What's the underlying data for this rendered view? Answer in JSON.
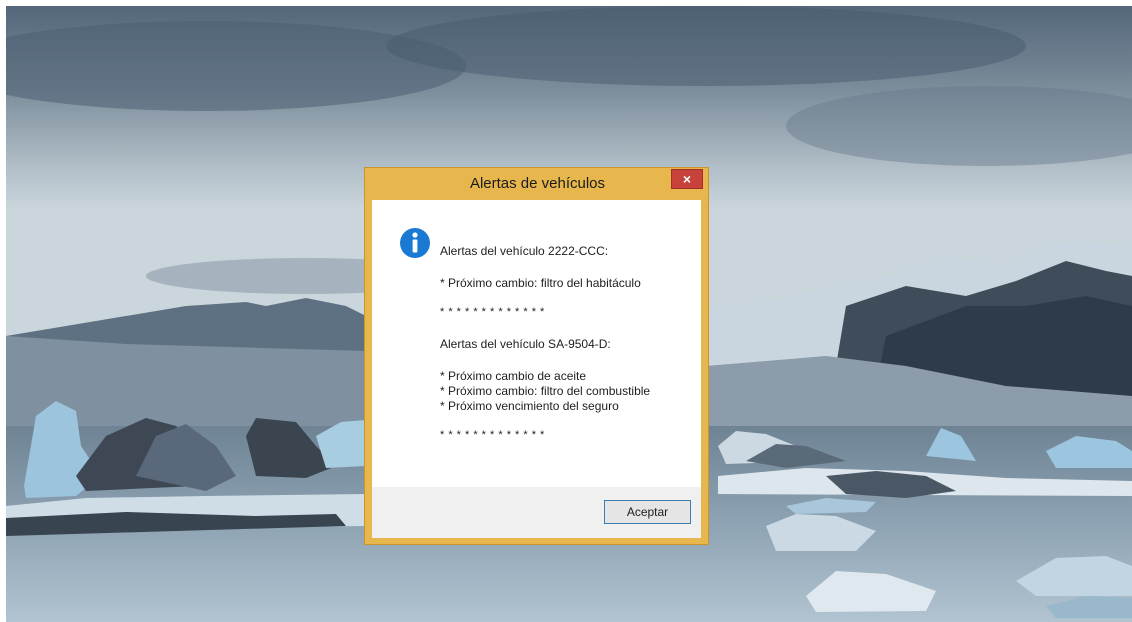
{
  "dialog": {
    "title": "Alertas de vehículos",
    "close_label": "×",
    "icon": "info-icon",
    "message_lines": [
      "Alertas del vehículo 2222-CCC:",
      "* Próximo cambio: filtro del habitáculo",
      "* * * * * * * * * * * * *",
      "Alertas del vehículo SA-9504-D:",
      "* Próximo cambio de aceite",
      "* Próximo cambio: filtro del combustible",
      "* Próximo vencimiento del seguro",
      "* * * * * * * * * * * * *"
    ],
    "ok_label": "Aceptar"
  },
  "colors": {
    "title_bar": "#e7b64c",
    "close_button": "#c7423a",
    "info_icon": "#1a7ad3",
    "button_border": "#3c7fb1"
  }
}
